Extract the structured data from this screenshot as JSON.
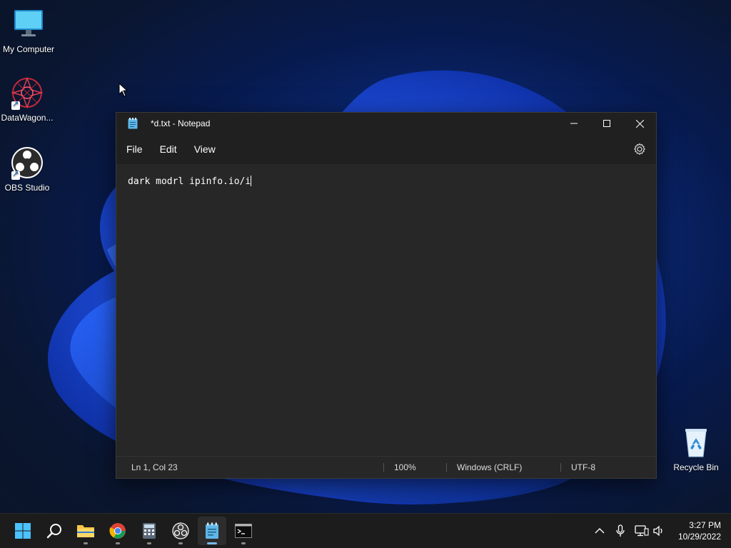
{
  "desktop": {
    "icons": [
      {
        "label": "My Computer",
        "icon": "monitor-icon"
      },
      {
        "label": "DataWagon...",
        "icon": "datawagon-icon"
      },
      {
        "label": "OBS Studio",
        "icon": "obs-icon"
      },
      {
        "label": "Recycle Bin",
        "icon": "recycle-bin-icon"
      }
    ]
  },
  "notepad": {
    "title": "*d.txt - Notepad",
    "menu": [
      "File",
      "Edit",
      "View"
    ],
    "content": "dark modrl ipinfo.io/i",
    "status": {
      "position": "Ln 1, Col 23",
      "zoom": "100%",
      "line_ending": "Windows (CRLF)",
      "encoding": "UTF-8"
    }
  },
  "taskbar": {
    "apps": [
      "start-icon",
      "search-icon",
      "file-explorer-icon",
      "chrome-icon",
      "calculator-icon",
      "obs-icon",
      "notepad-icon",
      "terminal-icon"
    ],
    "active_app": "notepad-icon",
    "clock": {
      "time": "3:27 PM",
      "date": "10/29/2022"
    }
  },
  "colors": {
    "accent": "#76b9ed",
    "window_bg": "#272727",
    "titlebar_bg": "#202020",
    "taskbar_bg": "#1c1c1c"
  }
}
